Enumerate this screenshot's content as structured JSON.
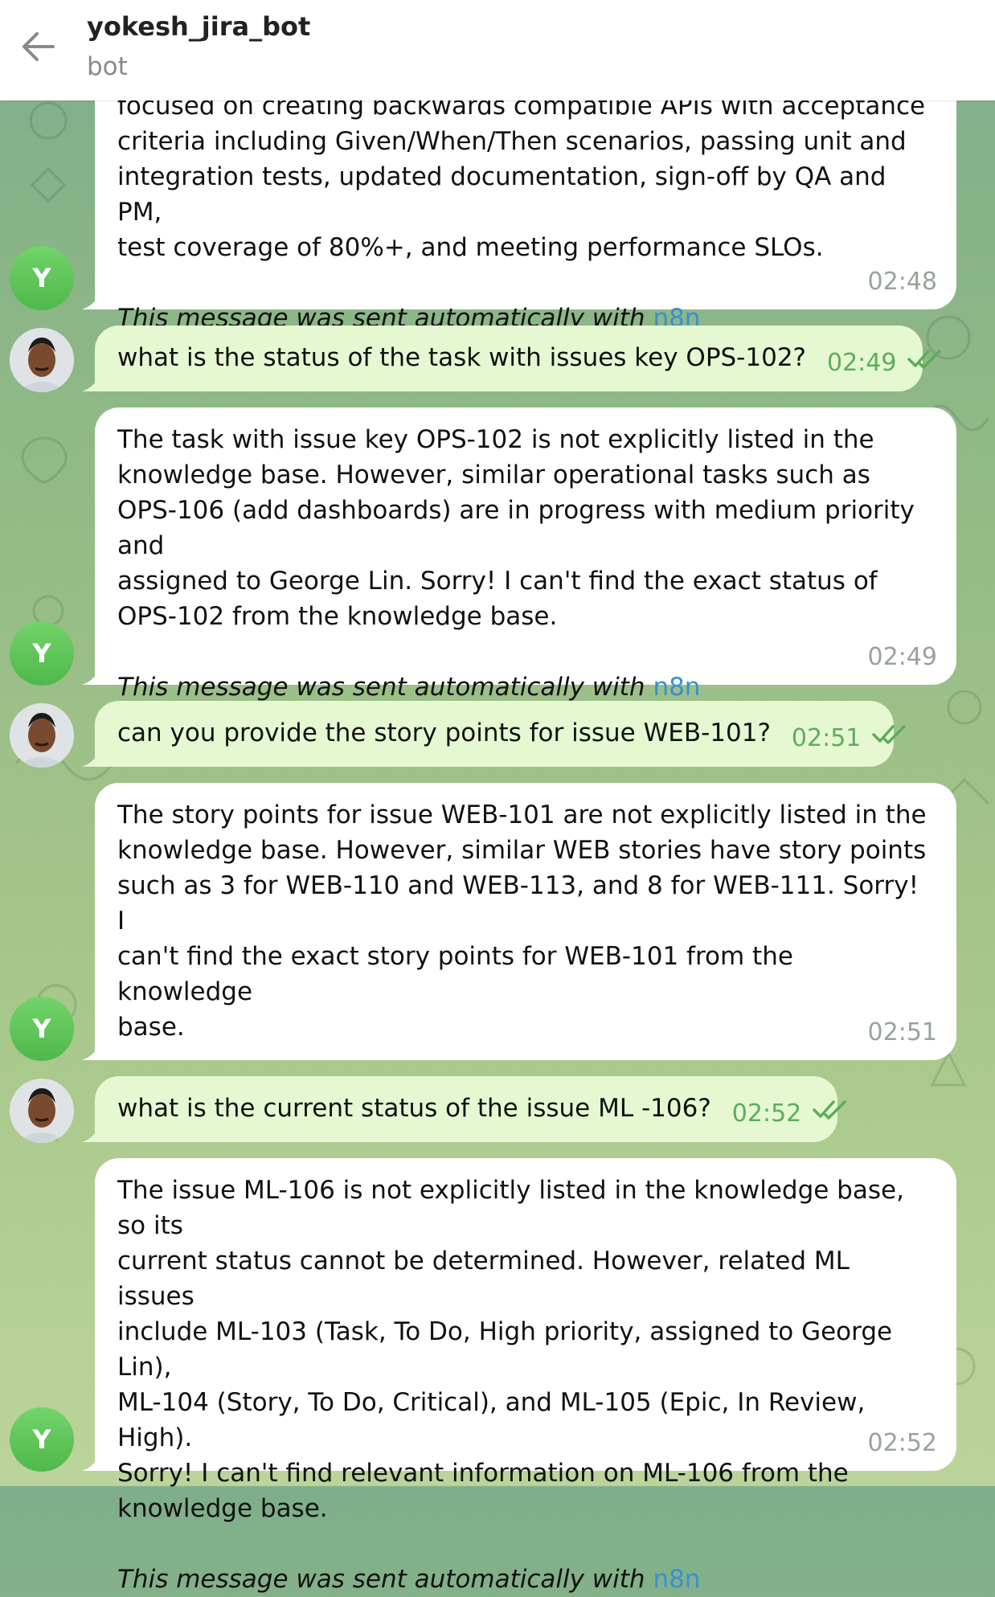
{
  "header": {
    "title": "yokesh_jira_bot",
    "subtitle": "bot"
  },
  "avatar_initial": "Y",
  "footer_prefix": "This message was sent automatically with ",
  "footer_link": "n8n",
  "messages": [
    {
      "sender": "bot",
      "lines": [
        "focused on creating backwards compatible APIs with acceptance",
        "criteria including Given/When/Then scenarios, passing unit and",
        "integration tests, updated documentation, sign-off by QA and PM,",
        "test coverage of 80%+, and meeting performance SLOs."
      ],
      "time": "02:48"
    },
    {
      "sender": "user",
      "text": "what is the status of the task with issues key OPS-102?",
      "time": "02:49"
    },
    {
      "sender": "bot",
      "lines": [
        "The task with issue key OPS-102 is not explicitly listed in the",
        "knowledge base. However, similar operational tasks such as",
        "OPS-106 (add dashboards) are in progress with medium priority and",
        "assigned to George Lin. Sorry! I can't find the exact status of",
        "OPS-102 from the knowledge base."
      ],
      "time": "02:49"
    },
    {
      "sender": "user",
      "text": "can you provide the story points for issue WEB-101?",
      "time": "02:51"
    },
    {
      "sender": "bot",
      "lines": [
        "The story points for issue WEB-101 are not explicitly listed in the",
        "knowledge base. However, similar WEB stories have story points",
        "such as 3 for WEB-110 and WEB-113, and 8 for WEB-111. Sorry! I",
        "can't find the exact story points for WEB-101 from the knowledge",
        "base."
      ],
      "time": "02:51"
    },
    {
      "sender": "user",
      "text": "what is the current status of the issue ML -106?",
      "time": "02:52"
    },
    {
      "sender": "bot",
      "lines": [
        "The issue ML-106 is not explicitly listed in the knowledge base, so its",
        "current status cannot be determined. However, related ML issues",
        "include ML-103 (Task, To Do, High priority, assigned to George Lin),",
        "ML-104 (Story, To Do, Critical), and ML-105 (Epic, In Review, High).",
        "Sorry! I can't find relevant information on ML-106 from the",
        "knowledge base."
      ],
      "time": "02:52"
    }
  ],
  "colors": {
    "bot_bubble": "#ffffff",
    "user_bubble": "#e6f8d2",
    "link": "#3a8fd0",
    "avatar_green": "#5cc454",
    "user_time": "#5cad5c",
    "bot_time": "#98a39a"
  },
  "icons": [
    "back-arrow-icon",
    "double-check-icon",
    "user-avatar-photo"
  ]
}
